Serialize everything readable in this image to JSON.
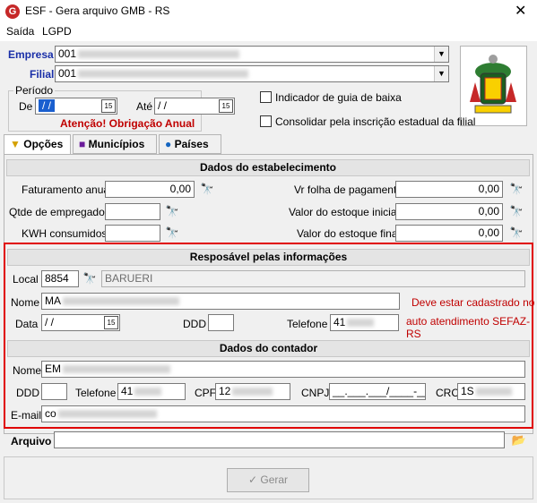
{
  "window": {
    "title": "ESF - Gera arquivo GMB - RS",
    "app_icon": "G"
  },
  "menu": [
    "Saída",
    "LGPD"
  ],
  "empresa": {
    "label": "Empresa",
    "code": "001"
  },
  "filial": {
    "label": "Filial",
    "code": "001"
  },
  "periodo": {
    "label": "Período",
    "de_label": "De",
    "de_value": "/ /",
    "ate_label": "Até",
    "ate_value": "/ /",
    "warning": "Atenção! Obrigação Anual"
  },
  "checkboxes": {
    "guia_baixa": "Indicador de guia de baixa",
    "consolidar": "Consolidar pela inscrição estadual da filial"
  },
  "tabs": [
    "Opções",
    "Municípios",
    "Países"
  ],
  "estabelecimento": {
    "title": "Dados do estabelecimento",
    "faturamento_label": "Faturamento anual",
    "faturamento_value": "0,00",
    "qtde_label": "Qtde de empregados",
    "kwh_label": "KWH consumidos",
    "folha_label": "Vr folha de pagamento",
    "folha_value": "0,00",
    "estoque_ini_label": "Valor do estoque inicial",
    "estoque_ini_value": "0,00",
    "estoque_fin_label": "Valor do estoque final",
    "estoque_fin_value": "0,00"
  },
  "responsavel": {
    "title": "Resposável pelas informações",
    "local_label": "Local",
    "local_code": "8854",
    "local_city": "BARUERI",
    "nome_label": "Nome",
    "nome_value": "MA",
    "data_label": "Data",
    "data_value": "/ /",
    "ddd_label": "DDD",
    "telefone_label": "Telefone",
    "telefone_value": "41",
    "warning_line1": "Deve estar cadastrado no",
    "warning_line2": "auto atendimento SEFAZ-RS"
  },
  "contador": {
    "title": "Dados do contador",
    "nome_label": "Nome",
    "nome_value": "EM",
    "ddd_label": "DDD",
    "telefone_label": "Telefone",
    "telefone_value": "41",
    "cpf_label": "CPF",
    "cpf_value": "12",
    "cnpj_label": "CNPJ",
    "cnpj_value": "__.___.___/____-__",
    "crc_label": "CRC",
    "crc_value": "1S",
    "email_label": "E-mail",
    "email_value": "co"
  },
  "arquivo": {
    "label": "Arquivo"
  },
  "buttons": {
    "gerar": "Gerar"
  },
  "colors": {
    "accent_blue": "#1a2fa8",
    "warning_red": "#c00000",
    "highlight_red": "#e00000"
  }
}
